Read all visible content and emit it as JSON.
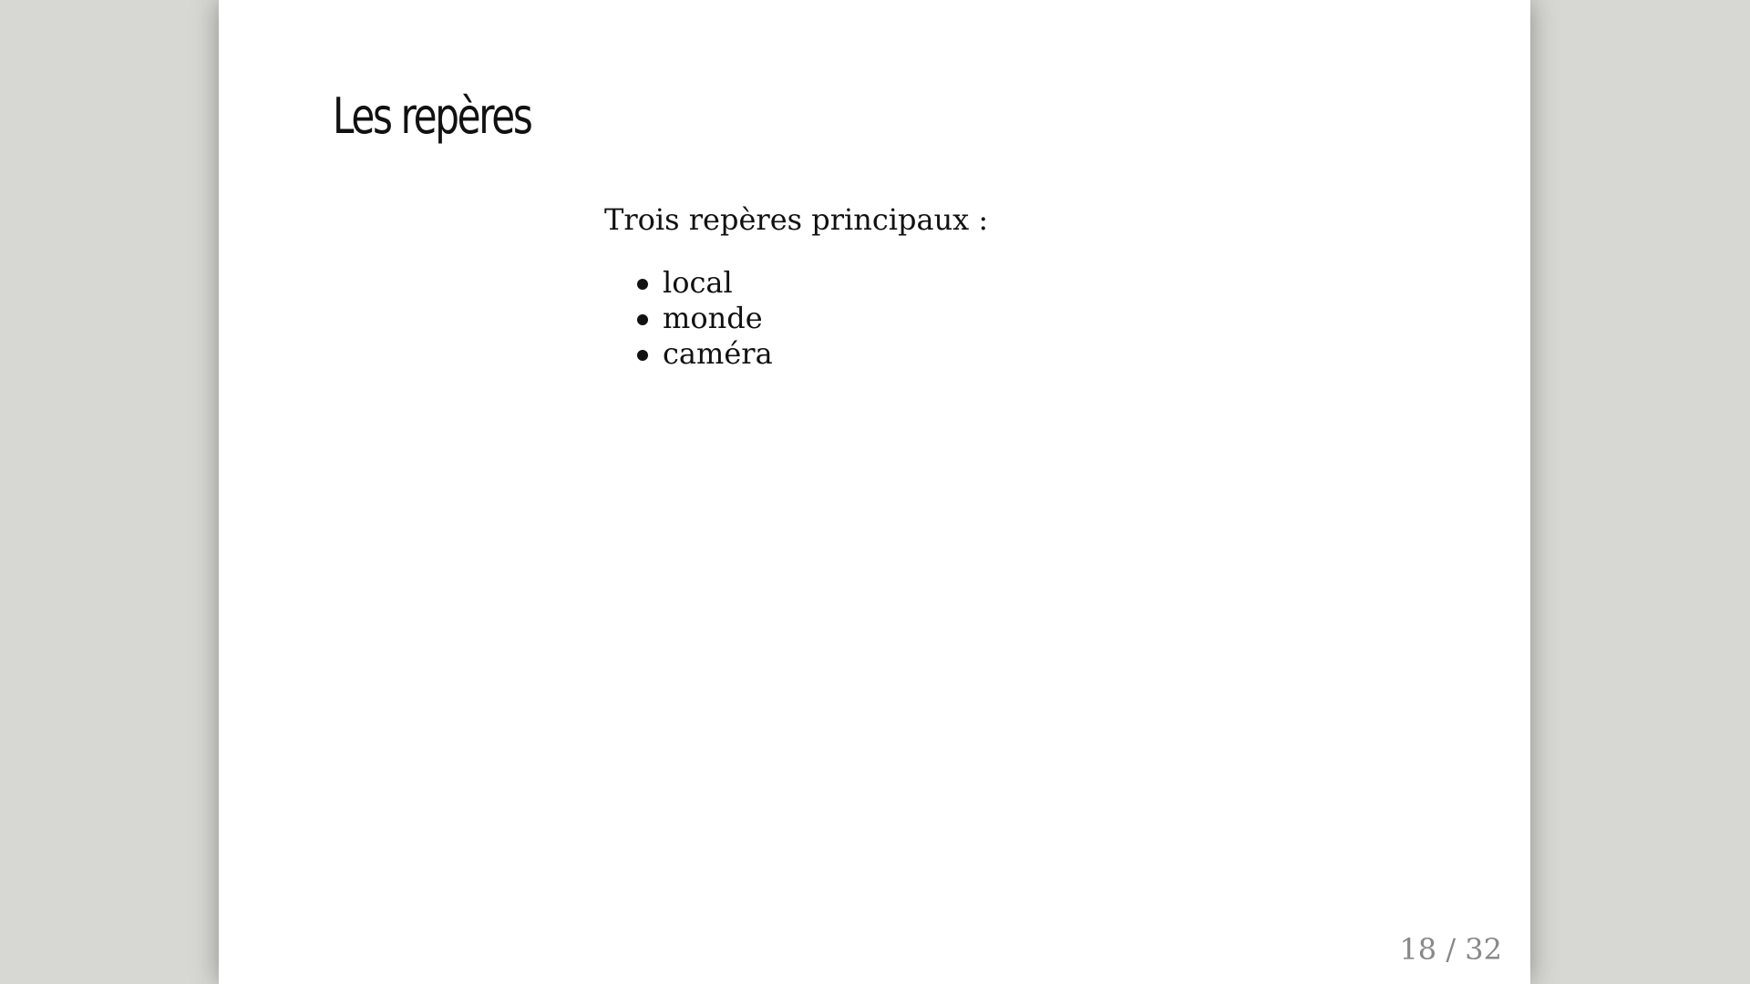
{
  "slide": {
    "title": "Les repères",
    "intro": "Trois repères principaux :",
    "items": [
      {
        "label": "local"
      },
      {
        "label": "monde"
      },
      {
        "label": "caméra"
      }
    ],
    "page_current": "18",
    "page_separator": " / ",
    "page_total": "32"
  },
  "colors": {
    "background": "#d7d8d3",
    "slide_background": "#ffffff",
    "text": "#111111",
    "page_counter": "#888888"
  }
}
